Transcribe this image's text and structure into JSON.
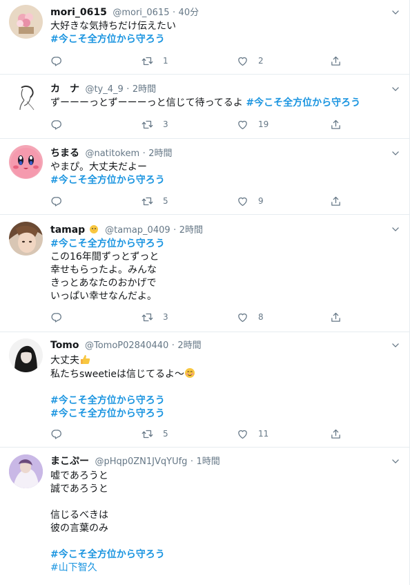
{
  "colors": {
    "accent": "#1b95e0",
    "muted": "#657786",
    "text": "#14171a",
    "border": "#e6ecf0"
  },
  "icons": {
    "reply": "reply-icon",
    "retweet": "retweet-icon",
    "like": "heart-icon",
    "share": "share-icon",
    "menu": "chevron-down-icon"
  },
  "tweets": [
    {
      "name": "mori_0615",
      "handle": "@mori_0615",
      "dot": "·",
      "time": "40分",
      "lines": [
        "大好きな気持ちだけ伝えたい"
      ],
      "tags": [
        "#今こそ全方位から守ろう"
      ],
      "retweets": "1",
      "likes": "2"
    },
    {
      "name": "カ　ナ",
      "handle": "@ty_4_9",
      "dot": "·",
      "time": "2時間",
      "text": "ずーーーっとずーーーっと信じて待ってるよ ",
      "tag_inline": "#今こそ全方位から守ろう",
      "retweets": "3",
      "likes": "19"
    },
    {
      "name": "ちまる",
      "handle": "@natitokem",
      "dot": "·",
      "time": "2時間",
      "lines": [
        "やまぴ。大丈夫だよー"
      ],
      "tags": [
        "#今こそ全方位から守ろう"
      ],
      "retweets": "5",
      "likes": "9"
    },
    {
      "name": "tamap",
      "handle": "@tamap_0409",
      "dot": "·",
      "time": "2時間",
      "tag": "#今こそ全方位から守ろう",
      "lines": [
        "この16年間ずっとずっと",
        "幸せもらったよ。みんな",
        "きっとあなたのおかげで",
        "いっぱい幸せなんだよ。"
      ],
      "retweets": "3",
      "likes": "8"
    },
    {
      "name": "Tomo",
      "handle": "@TomoP02840440",
      "dot": "·",
      "time": "2時間",
      "line1": "大丈夫",
      "line2": "私たちsweetieは信じてるよ〜",
      "tags": [
        "#今こそ全方位から守ろう",
        "#今こそ全方位から守ろう"
      ],
      "retweets": "5",
      "likes": "11"
    },
    {
      "name": "まこぷー",
      "handle": "@pHqp0ZN1JVqYUfg",
      "dot": "·",
      "time": "1時間",
      "lines": [
        "嘘であろうと",
        "誠であろうと",
        "",
        "信じるべきは",
        "彼の言葉のみ"
      ],
      "tag": "#今こそ全方位から守ろう",
      "tag2": "#山下智久"
    }
  ]
}
